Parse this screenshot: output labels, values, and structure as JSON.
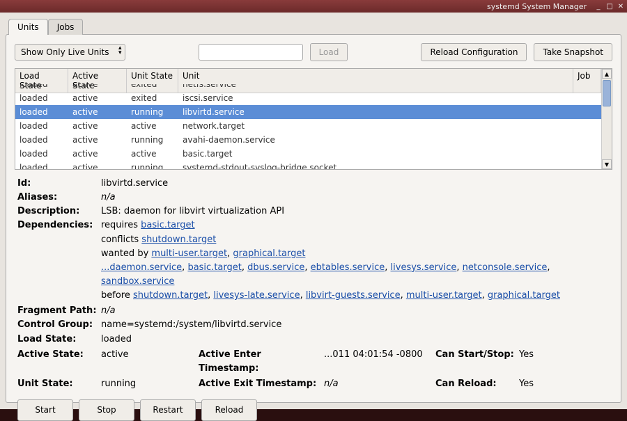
{
  "titlebar": {
    "title": "systemd System Manager"
  },
  "tabs": {
    "units": "Units",
    "jobs": "Jobs",
    "active": "units"
  },
  "toolbar": {
    "filter_label": "Show Only Live Units",
    "load_btn": "Load",
    "reload_cfg_btn": "Reload Configuration",
    "snapshot_btn": "Take Snapshot"
  },
  "columns": {
    "load": "Load State",
    "active": "Active State",
    "unit_state": "Unit State",
    "unit": "Unit",
    "job": "Job"
  },
  "rows": [
    {
      "load": "loaded",
      "active": "active",
      "unit_state": "exited",
      "unit": "netfs.service",
      "selected": false,
      "partial": true
    },
    {
      "load": "loaded",
      "active": "active",
      "unit_state": "exited",
      "unit": "iscsi.service",
      "selected": false
    },
    {
      "load": "loaded",
      "active": "active",
      "unit_state": "running",
      "unit": "libvirtd.service",
      "selected": true
    },
    {
      "load": "loaded",
      "active": "active",
      "unit_state": "active",
      "unit": "network.target",
      "selected": false
    },
    {
      "load": "loaded",
      "active": "active",
      "unit_state": "running",
      "unit": "avahi-daemon.service",
      "selected": false
    },
    {
      "load": "loaded",
      "active": "active",
      "unit_state": "active",
      "unit": "basic.target",
      "selected": false
    },
    {
      "load": "loaded",
      "active": "active",
      "unit_state": "running",
      "unit": "systemd-stdout-syslog-bridge.socket",
      "selected": false
    }
  ],
  "details": {
    "labels": {
      "id": "Id:",
      "aliases": "Aliases:",
      "description": "Description:",
      "dependencies": "Dependencies:",
      "fragment_path": "Fragment Path:",
      "control_group": "Control Group:",
      "load_state": "Load State:",
      "active_state": "Active State:",
      "unit_state": "Unit State:",
      "active_enter": "Active Enter Timestamp:",
      "active_exit": "Active Exit Timestamp:",
      "can_start_stop": "Can Start/Stop:",
      "can_reload": "Can Reload:"
    },
    "id": "libvirtd.service",
    "aliases": "n/a",
    "description": "LSB: daemon for libvirt virtualization API",
    "deps": {
      "requires_word": "requires ",
      "requires": [
        "basic.target"
      ],
      "conflicts_word": "conflicts ",
      "conflicts": [
        "shutdown.target"
      ],
      "wanted_by_word": "wanted by ",
      "wanted_by": [
        "multi-user.target",
        "graphical.target"
      ],
      "line4": [
        "...daemon.service",
        "basic.target",
        "dbus.service",
        "ebtables.service",
        "livesys.service",
        "netconsole.service",
        "sandbox.service"
      ],
      "before_word": "before ",
      "before": [
        "shutdown.target",
        "livesys-late.service",
        "libvirt-guests.service",
        "multi-user.target",
        "graphical.target"
      ]
    },
    "fragment_path": "n/a",
    "control_group": "name=systemd:/system/libvirtd.service",
    "load_state": "loaded",
    "active_state": "active",
    "unit_state": "running",
    "active_enter": "...011 04:01:54 -0800",
    "active_exit": "n/a",
    "can_start_stop": "Yes",
    "can_reload": "Yes"
  },
  "actions": {
    "start": "Start",
    "stop": "Stop",
    "restart": "Restart",
    "reload": "Reload"
  }
}
